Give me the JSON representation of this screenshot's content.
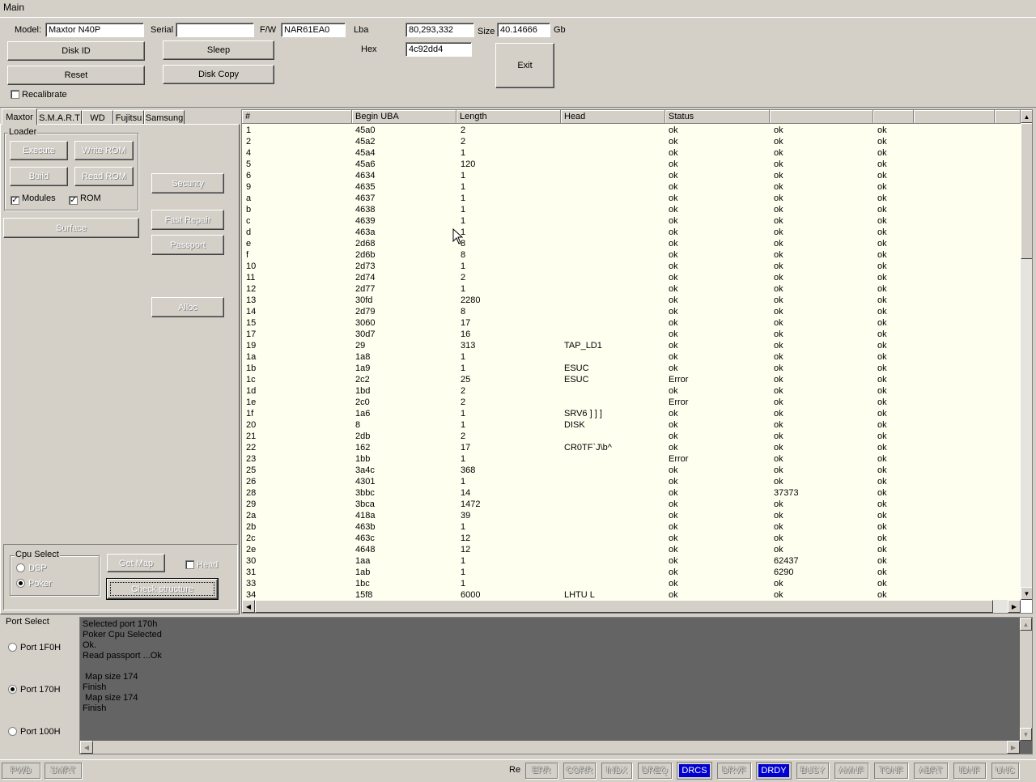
{
  "window": {
    "title": "Main"
  },
  "top": {
    "model_label": "Model:",
    "model_value": "Maxtor N40P",
    "serial_label": "Serial",
    "serial_value": "",
    "fw_label": "F/W",
    "fw_value": "NAR61EA0",
    "lba_label": "Lba",
    "lba_value": "80,293,332",
    "size_label": "Size",
    "size_value": "40.14666",
    "size_unit": "Gb",
    "hex_label": "Hex",
    "hex_value": "4c92dd4",
    "disk_id": "Disk ID",
    "sleep": "Sleep",
    "reset": "Reset",
    "disk_copy": "Disk Copy",
    "exit": "Exit",
    "recalibrate": "Recalibrate"
  },
  "tabs": [
    "Maxtor",
    "S.M.A.R.T",
    "WD",
    "Fujitsu",
    "Samsung"
  ],
  "loader": {
    "title": "Loader",
    "execute": "Execute",
    "write_rom": "Write ROM",
    "build": "Build",
    "read_rom": "Read ROM",
    "modules": "Modules",
    "rom": "ROM",
    "modules_checked": true,
    "rom_checked": true
  },
  "side_buttons": {
    "surface": "Surface",
    "security": "Security",
    "fast_repair": "Fast Repair",
    "passport": "Passport",
    "alloc": "Alloc"
  },
  "cpu_select": {
    "title": "Cpu Select",
    "dsp": "DSP",
    "poker": "Poker",
    "selected": "Poker",
    "get_map": "Get Map",
    "head": "Head",
    "check_structure": "Check structure"
  },
  "grid": {
    "headers": [
      "#",
      "Begin UBA",
      "Length",
      "Head",
      "Status",
      "",
      "",
      "",
      ""
    ],
    "rows": [
      [
        "1",
        "45a0",
        "2",
        "",
        "ok",
        "ok",
        "ok"
      ],
      [
        "2",
        "45a2",
        "2",
        "",
        "ok",
        "ok",
        "ok"
      ],
      [
        "4",
        "45a4",
        "1",
        "",
        "ok",
        "ok",
        "ok"
      ],
      [
        "5",
        "45a6",
        "120",
        "",
        "ok",
        "ok",
        "ok"
      ],
      [
        "6",
        "4634",
        "1",
        "",
        "ok",
        "ok",
        "ok"
      ],
      [
        "9",
        "4635",
        "1",
        "",
        "ok",
        "ok",
        "ok"
      ],
      [
        "a",
        "4637",
        "1",
        "",
        "ok",
        "ok",
        "ok"
      ],
      [
        "b",
        "4638",
        "1",
        "",
        "ok",
        "ok",
        "ok"
      ],
      [
        "c",
        "4639",
        "1",
        "",
        "ok",
        "ok",
        "ok"
      ],
      [
        "d",
        "463a",
        "1",
        "",
        "ok",
        "ok",
        "ok"
      ],
      [
        "e",
        "2d68",
        "8",
        "",
        "ok",
        "ok",
        "ok"
      ],
      [
        "f",
        "2d6b",
        "8",
        "",
        "ok",
        "ok",
        "ok"
      ],
      [
        "10",
        "2d73",
        "1",
        "",
        "ok",
        "ok",
        "ok"
      ],
      [
        "11",
        "2d74",
        "2",
        "",
        "ok",
        "ok",
        "ok"
      ],
      [
        "12",
        "2d77",
        "1",
        "",
        "ok",
        "ok",
        "ok"
      ],
      [
        "13",
        "30fd",
        "2280",
        "",
        "ok",
        "ok",
        "ok"
      ],
      [
        "14",
        "2d79",
        "8",
        "",
        "ok",
        "ok",
        "ok"
      ],
      [
        "15",
        "3060",
        "17",
        "",
        "ok",
        "ok",
        "ok"
      ],
      [
        "17",
        "30d7",
        "16",
        "",
        "ok",
        "ok",
        "ok"
      ],
      [
        "19",
        "29",
        "313",
        "TAP_LD1",
        "ok",
        "ok",
        "ok"
      ],
      [
        "1a",
        "1a8",
        "1",
        "",
        "ok",
        "ok",
        "ok"
      ],
      [
        "1b",
        "1a9",
        "1",
        "ESUC",
        "ok",
        "ok",
        "ok"
      ],
      [
        "1c",
        "2c2",
        "25",
        "ESUC",
        "Error",
        "ok",
        "ok"
      ],
      [
        "1d",
        "1bd",
        "2",
        "",
        "ok",
        "ok",
        "ok"
      ],
      [
        "1e",
        "2c0",
        "2",
        "",
        "Error",
        "ok",
        "ok"
      ],
      [
        "1f",
        "1a6",
        "1",
        "SRV6 ] ] ]",
        "ok",
        "ok",
        "ok"
      ],
      [
        "20",
        "8",
        "1",
        "DISK",
        "ok",
        "ok",
        "ok"
      ],
      [
        "21",
        "2db",
        "2",
        "",
        "ok",
        "ok",
        "ok"
      ],
      [
        "22",
        "162",
        "17",
        "CR0TF`J\\b^",
        "ok",
        "ok",
        "ok"
      ],
      [
        "23",
        "1bb",
        "1",
        "",
        "Error",
        "ok",
        "ok"
      ],
      [
        "25",
        "3a4c",
        "368",
        "",
        "ok",
        "ok",
        "ok"
      ],
      [
        "26",
        "4301",
        "1",
        "",
        "ok",
        "ok",
        "ok"
      ],
      [
        "28",
        "3bbc",
        "14",
        "",
        "ok",
        "37373",
        "ok"
      ],
      [
        "29",
        "3bca",
        "1472",
        "",
        "ok",
        "ok",
        "ok"
      ],
      [
        "2a",
        "418a",
        "39",
        "",
        "ok",
        "ok",
        "ok"
      ],
      [
        "2b",
        "463b",
        "1",
        "",
        "ok",
        "ok",
        "ok"
      ],
      [
        "2c",
        "463c",
        "12",
        "",
        "ok",
        "ok",
        "ok"
      ],
      [
        "2e",
        "4648",
        "12",
        "",
        "ok",
        "ok",
        "ok"
      ],
      [
        "30",
        "1aa",
        "1",
        "",
        "ok",
        "62437",
        "ok"
      ],
      [
        "31",
        "1ab",
        "1",
        "",
        "ok",
        "6290",
        "ok"
      ],
      [
        "33",
        "1bc",
        "1",
        "",
        "ok",
        "ok",
        "ok"
      ],
      [
        "34",
        "15f8",
        "6000",
        "LHTU L",
        "ok",
        "ok",
        "ok"
      ]
    ]
  },
  "port_select": {
    "title": "Port Select",
    "ports": [
      "Port 1F0H",
      "Port 170H",
      "Port 100H"
    ],
    "selected": "Port 170H"
  },
  "log": {
    "lines": [
      "Selected port 170h",
      "Poker Cpu Selected",
      "Ok.",
      "Read passport ...Ok",
      "",
      " Map size 174",
      "Finish",
      " Map size 174",
      "Finish"
    ]
  },
  "status_bar": {
    "pwd": "PWD",
    "smrt": "SMRT",
    "truncated": "Re",
    "indicators": [
      {
        "label": "ERR",
        "lit": false
      },
      {
        "label": "CORR",
        "lit": false
      },
      {
        "label": "INDX",
        "lit": false
      },
      {
        "label": "DREQ",
        "lit": false
      },
      {
        "label": "DRCS",
        "lit": true
      },
      {
        "label": "DRVF",
        "lit": false
      },
      {
        "label": "DRDY",
        "lit": true
      },
      {
        "label": "BUSY",
        "lit": false
      },
      {
        "label": "AMNF",
        "lit": false
      },
      {
        "label": "TONF",
        "lit": false
      },
      {
        "label": "ABRT",
        "lit": false
      },
      {
        "label": "IDNF",
        "lit": false
      },
      {
        "label": "UNC",
        "lit": false
      }
    ]
  },
  "colors": {
    "lit_indicator": "#0000d0",
    "grid_bg": "#fffff0",
    "log_bg": "#646464",
    "face": "#d4d0c8"
  }
}
